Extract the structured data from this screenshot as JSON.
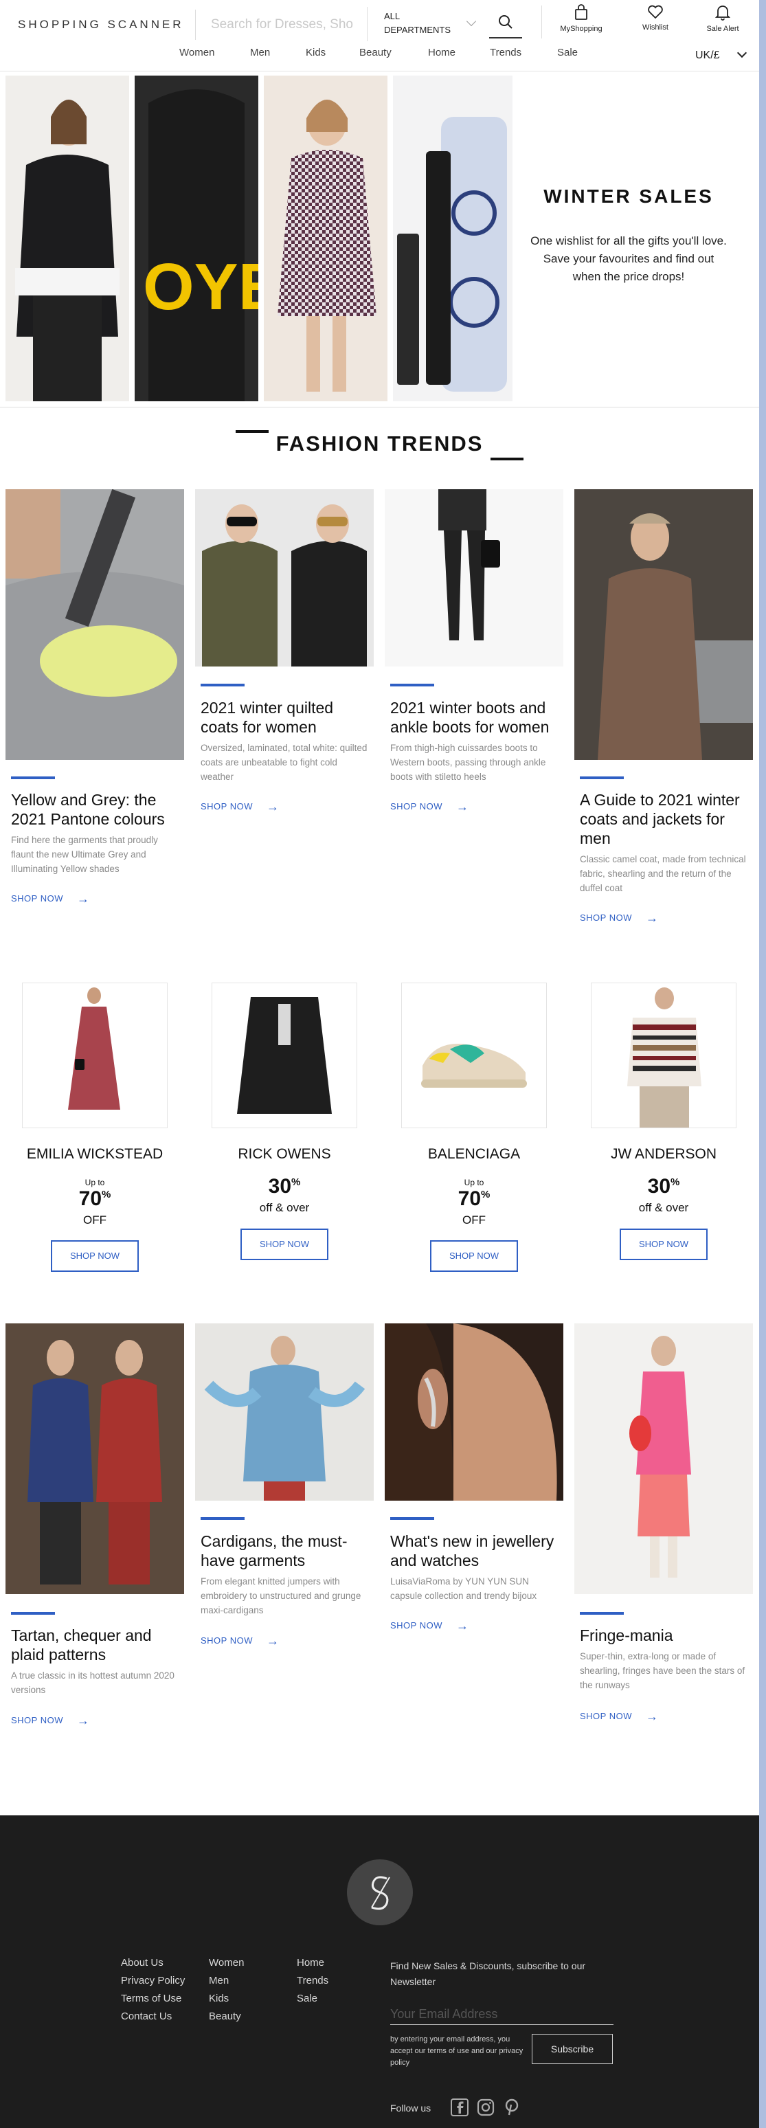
{
  "header": {
    "logo": "SHOPPING SCANNER",
    "search_placeholder": "Search for Dresses, Sho",
    "department": "ALL DEPARTMENTS",
    "myshopping_label": "MyShopping",
    "wishlist_label": "Wishlist",
    "sale_alert_label": "Sale Alert",
    "region": "UK/£"
  },
  "nav": [
    "Women",
    "Men",
    "Kids",
    "Beauty",
    "Home",
    "Trends",
    "Sale"
  ],
  "hero": {
    "title": "WINTER SALES",
    "text": "One wishlist for all the gifts you'll love. Save your favourites and find out when the price drops!"
  },
  "fashion_trends": {
    "title": "FASHION TRENDS",
    "shop_label": "SHOP NOW",
    "cards": [
      {
        "title": "Yellow and Grey: the 2021 Pantone colours",
        "desc": "Find here the garments that proudly flaunt the new Ultimate Grey and Illuminating Yellow shades"
      },
      {
        "title": "2021 winter quilted coats for women",
        "desc": "Oversized, laminated, total white: quilted coats are unbeatable to fight cold weather"
      },
      {
        "title": "2021 winter boots and ankle boots for women",
        "desc": "From thigh-high cuissardes boots to Western boots, passing through ankle boots with stiletto heels"
      },
      {
        "title": "A Guide to 2021 winter coats and jackets for men",
        "desc": "Classic camel coat, made from technical fabric, shearling and the return of the duffel coat"
      },
      {
        "title": "Tartan, chequer and plaid patterns",
        "desc": "A true classic in its hottest autumn 2020 versions"
      },
      {
        "title": "Cardigans, the must-have garments",
        "desc": "From elegant knitted jumpers with embroidery to unstructured and grunge maxi-cardigans"
      },
      {
        "title": "What's new in jewellery and watches",
        "desc": "LuisaViaRoma by YUN YUN SUN capsule collection and trendy bijoux"
      },
      {
        "title": "Fringe-mania",
        "desc": "Super-thin, extra-long or made of shearling, fringes have been the stars of the runways"
      }
    ]
  },
  "deals": [
    {
      "brand": "EMILIA WICKSTEAD",
      "upto": "Up to",
      "pct": "70",
      "suffix": "OFF",
      "button": "SHOP NOW"
    },
    {
      "brand": "RICK OWENS",
      "upto": "",
      "pct": "30",
      "suffix": "off & over",
      "button": "SHOP NOW"
    },
    {
      "brand": "BALENCIAGA",
      "upto": "Up to",
      "pct": "70",
      "suffix": "OFF",
      "button": "SHOP NOW"
    },
    {
      "brand": "JW ANDERSON",
      "upto": "",
      "pct": "30",
      "suffix": "off & over",
      "button": "SHOP NOW"
    }
  ],
  "footer": {
    "col1": [
      "About Us",
      "Privacy Policy",
      "Terms of Use",
      "Contact Us"
    ],
    "col2": [
      "Women",
      "Men",
      "Kids",
      "Beauty"
    ],
    "col3": [
      "Home",
      "Trends",
      "Sale"
    ],
    "newsletter_text": "Find New Sales & Discounts, subscribe to our Newsletter",
    "email_placeholder": "Your Email Address",
    "disclaimer": "by entering your email address, you accept our terms of use and our privacy policy",
    "subscribe": "Subscribe",
    "follow": "Follow us"
  },
  "colors": {
    "accent": "#2f5fc4",
    "footer_bg": "#1d1d1d"
  }
}
